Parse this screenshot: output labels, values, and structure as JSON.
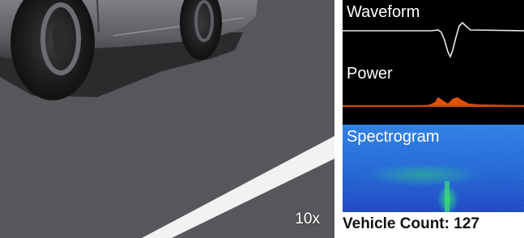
{
  "camera": {
    "speed_label": "10x"
  },
  "panels": {
    "waveform_title": "Waveform",
    "power_title": "Power",
    "spectrogram_title": "Spectrogram"
  },
  "status": {
    "vehicle_count_label": "Vehicle Count:",
    "vehicle_count_value": "127"
  },
  "colors": {
    "waveform_line": "#e8e8e8",
    "power_fill": "#e0520a",
    "spectrogram_base": "#0b2fb8",
    "spectrogram_energy": "#2fd36a"
  }
}
